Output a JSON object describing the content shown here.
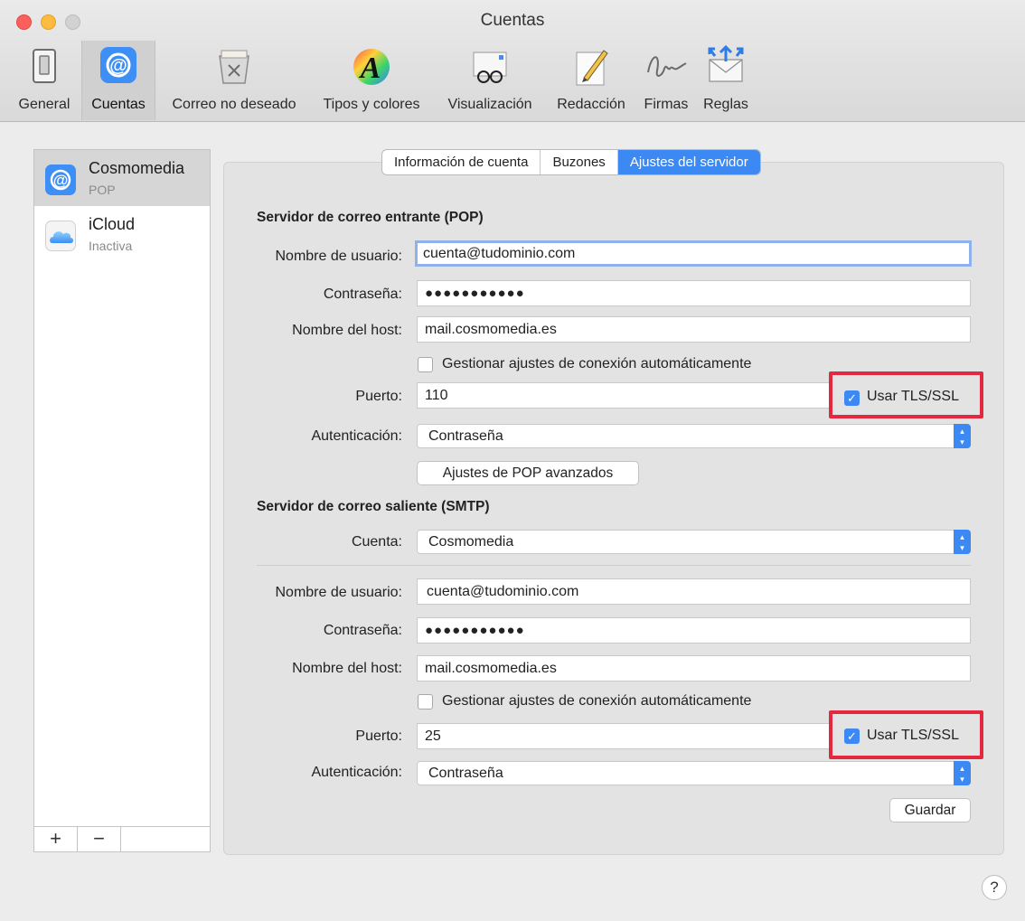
{
  "window": {
    "title": "Cuentas"
  },
  "toolbar": {
    "items": [
      {
        "label": "General",
        "icon": "switch-icon"
      },
      {
        "label": "Cuentas",
        "icon": "at-icon"
      },
      {
        "label": "Correo no deseado",
        "icon": "junk-trash-icon"
      },
      {
        "label": "Tipos y colores",
        "icon": "font-color-icon"
      },
      {
        "label": "Visualización",
        "icon": "glasses-icon"
      },
      {
        "label": "Redacción",
        "icon": "pencil-icon"
      },
      {
        "label": "Firmas",
        "icon": "signature-icon"
      },
      {
        "label": "Reglas",
        "icon": "rules-envelope-icon"
      }
    ],
    "selected": "Cuentas"
  },
  "sidebar": {
    "accounts": [
      {
        "name": "Cosmomedia",
        "type": "POP",
        "icon": "at-icon"
      },
      {
        "name": "iCloud",
        "type": "Inactiva",
        "icon": "cloud-icon"
      }
    ],
    "add_label": "+",
    "remove_label": "−"
  },
  "tabs": [
    "Información de cuenta",
    "Buzones",
    "Ajustes del servidor"
  ],
  "active_tab": "Ajustes del servidor",
  "incoming": {
    "heading": "Servidor de correo entrante (POP)",
    "username_label": "Nombre de usuario:",
    "username": "cuenta@tudominio.com",
    "password_label": "Contraseña:",
    "password": "●●●●●●●●●●●",
    "host_label": "Nombre del host:",
    "host": "mail.cosmomedia.es",
    "auto_label": "Gestionar ajustes de conexión automáticamente",
    "port_label": "Puerto:",
    "port": "110",
    "tls_label": "Usar TLS/SSL",
    "auth_label": "Autenticación:",
    "auth": "Contraseña",
    "advanced_button": "Ajustes de POP avanzados"
  },
  "outgoing": {
    "heading": "Servidor de correo saliente (SMTP)",
    "account_label": "Cuenta:",
    "account": "Cosmomedia",
    "username_label": "Nombre de usuario:",
    "username": "cuenta@tudominio.com",
    "password_label": "Contraseña:",
    "password": "●●●●●●●●●●●",
    "host_label": "Nombre del host:",
    "host": "mail.cosmomedia.es",
    "auto_label": "Gestionar ajustes de conexión automáticamente",
    "port_label": "Puerto:",
    "port": "25",
    "tls_label": "Usar TLS/SSL",
    "auth_label": "Autenticación:",
    "auth": "Contraseña"
  },
  "save_button": "Guardar",
  "help_label": "?",
  "colors": {
    "accent": "#3d89f3",
    "highlight": "#e3283f"
  }
}
